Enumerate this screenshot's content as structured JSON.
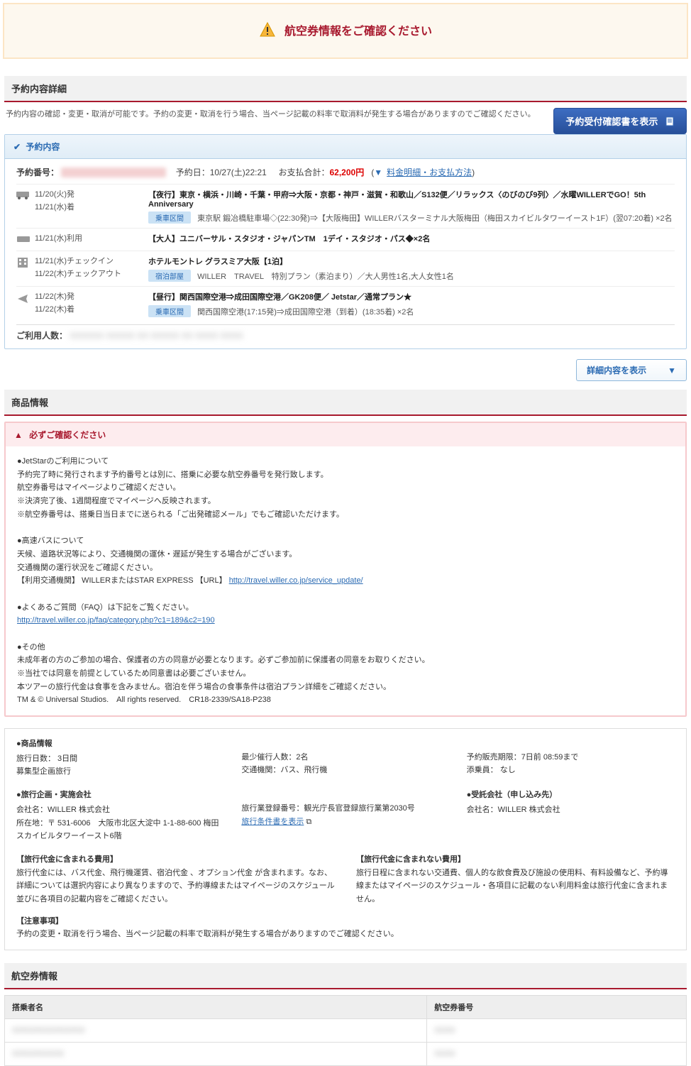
{
  "alert": {
    "text": "航空券情報をご確認ください"
  },
  "section_resv_detail_title": "予約内容詳細",
  "resv_detail_desc": "予約内容の確認・変更・取消が可能です。予約の変更・取消を行う場合、当ページ記載の料率で取消料が発生する場合がありますのでご確認ください。",
  "btn_receipt": "予約受付確認書を表示",
  "panel_resv_title": "予約内容",
  "resv": {
    "label_number": "予約番号：",
    "number_redacted": "XXXX-XXX-XXX",
    "date_label": "予約日：",
    "date": "10/27(土)22:21",
    "total_label": "お支払合計：",
    "total": "62,200円",
    "fee_link": "料金明細・お支払方法"
  },
  "items": [
    {
      "icon": "bus",
      "dates": [
        "11/20(火)発",
        "11/21(水)着"
      ],
      "title": "【夜行】東京・横浜・川崎・千葉・甲府⇒大阪・京都・神戸・滋賀・和歌山／S132便／リラックス〈のびのび9列〉／水曜WILLERでGO！5th Anniversary",
      "badge": "乗車区間",
      "detail": "東京駅 鍛冶橋駐車場◇(22:30発)⇒【大阪梅田】WILLERバスターミナル大阪梅田（梅田スカイビルタワーイースト1F）(翌07:20着) ×2名"
    },
    {
      "icon": "ticket",
      "dates": [
        "11/21(水)利用"
      ],
      "title": "【大人】ユニバーサル・スタジオ・ジャパンTM　1デイ・スタジオ・パス◆×2名"
    },
    {
      "icon": "hotel",
      "dates": [
        "11/21(水)チェックイン",
        "11/22(木)チェックアウト"
      ],
      "title": "ホテルモントレ グラスミア大阪【1泊】",
      "badge": "宿泊部屋",
      "detail": "WILLER　TRAVEL　特別プラン（素泊まり）／大人男性1名,大人女性1名"
    },
    {
      "icon": "plane",
      "dates": [
        "11/22(木)発",
        "11/22(木)着"
      ],
      "title": "【昼行】関西国際空港⇒成田国際空港／GK208便／ Jetstar／通常プラン★",
      "badge": "乗車区間",
      "detail": "関西国際空港(17:15発)⇒成田国際空港（到着）(18:35着) ×2名"
    }
  ],
  "usage_label": "ご利用人数：",
  "usage_redacted": "XXXXXX XXXXX XX XXXXX XX XXXX XXXX",
  "btn_detail_expand": "詳細内容を表示",
  "section_product_title": "商品情報",
  "notice_title": "必ずご確認ください",
  "notice_body": {
    "p1": "●JetStarのご利用について",
    "p2": "予約完了時に発行されます予約番号とは別に、搭乗に必要な航空券番号を発行致します。",
    "p3": "航空券番号はマイページよりご確認ください。",
    "p4": "※決済完了後、1週間程度でマイページへ反映されます。",
    "p5": "※航空券番号は、搭乗日当日までに送られる「ご出発確認メール」でもご確認いただけます。",
    "p6": "●高速バスについて",
    "p7": "天候、道路状況等により、交通機関の運休・遅延が発生する場合がございます。",
    "p8": "交通機関の運行状況をご確認ください。",
    "p9": "【利用交通機関】 WILLERまたはSTAR EXPRESS 【URL】",
    "url1": "http://travel.willer.co.jp/service_update/",
    "p10": "●よくあるご質問（FAQ）は下記をご覧ください。",
    "url2": "http://travel.willer.co.jp/faq/category.php?c1=189&c2=190",
    "p11": "●その他",
    "p12": "未成年者の方のご参加の場合、保護者の方の同意が必要となります。必ずご参加前に保護者の同意をお取りください。",
    "p13": "※当社では同意を前提としているため同意書は必要ございません。",
    "p14": "本ツアーの旅行代金は食事を含みません。宿泊を伴う場合の食事条件は宿泊プラン詳細をご確認ください。",
    "p15": "TM & © Universal Studios.　All rights reserved.　CR18-2339/SA18-P238"
  },
  "product_info": {
    "h1": "●商品情報",
    "days": "旅行日数： 3日間",
    "type": "募集型企画旅行",
    "min_pax": "最少催行人数：2名",
    "transport": "交通機関：バス、飛行機",
    "deadline": "予約販売期限：7日前 08:59まで",
    "attendant": "添乗員： なし",
    "h2": "●旅行企画・実施会社",
    "company": "会社名：WILLER 株式会社",
    "address": "所在地：〒 531-6006　大阪市北区大淀中 1-1-88-600 梅田スカイビルタワーイースト6階",
    "reg": "旅行業登録番号：観光庁長官登録旅行業第2030号",
    "cond_link": "旅行条件書を表示",
    "h3": "●受託会社（申し込み先）",
    "entrust": "会社名：WILLER 株式会社",
    "inc_h": "【旅行代金に含まれる費用】",
    "inc_t": "旅行代金には、バス代金、飛行機運賃、宿泊代金 、オプション代金 が含まれます。なお、詳細については選択内容により異なりますので、予約導線またはマイページのスケジュール並びに各項目の記載内容をご確認ください。",
    "exc_h": "【旅行代金に含まれない費用】",
    "exc_t": "旅行日程に含まれない交通費、個人的な飲食費及び施設の使用料、有料設備など、予約導線またはマイページのスケジュール・各項目に記載のない利用料金は旅行代金に含まれません。",
    "caution_h": "【注意事項】",
    "caution_t": "予約の変更・取消を行う場合、当ページ記載の料率で取消料が発生する場合がありますのでご確認ください。"
  },
  "section_flight_title": "航空券情報",
  "flight_table": {
    "th1": "搭乗者名",
    "th2": "航空券番号",
    "rows": [
      {
        "name": "XXXXXXXXXXXXXX",
        "num": "XXXX"
      },
      {
        "name": "XXXXXXXXXX",
        "num": "XXXX"
      }
    ]
  }
}
